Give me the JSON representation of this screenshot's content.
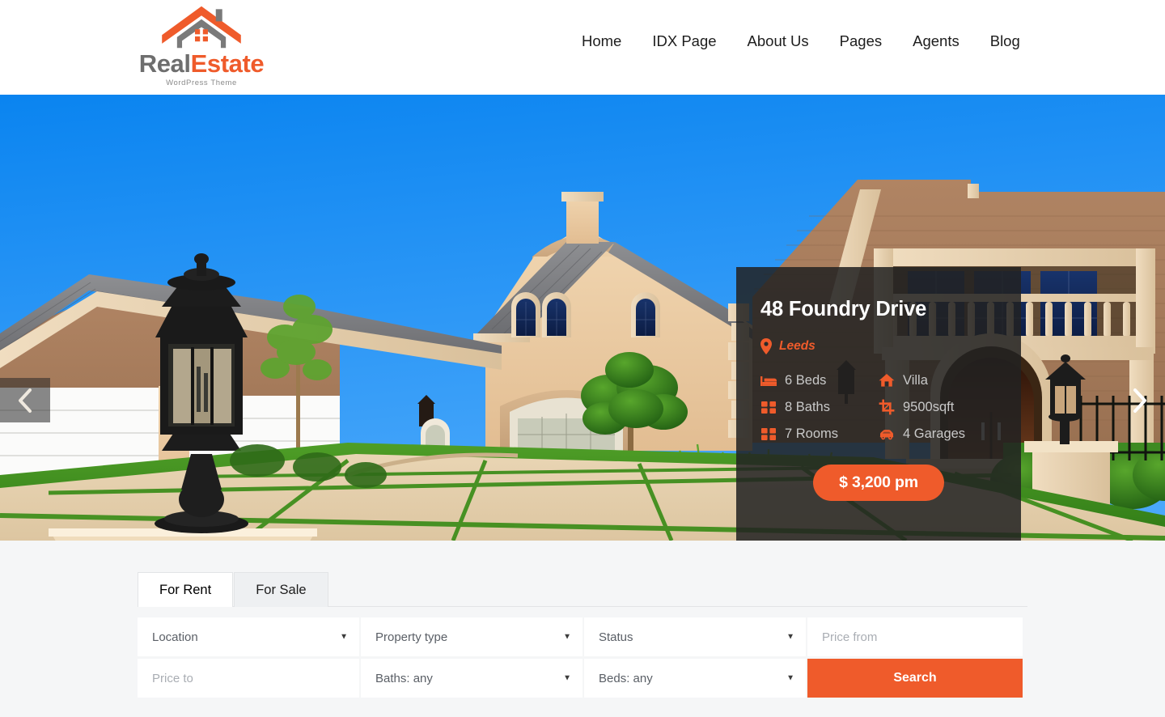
{
  "header": {
    "logo": {
      "word_primary": "Real",
      "word_accent": "Estate",
      "subtitle": "WordPress Theme",
      "icon": "house-logo-icon"
    },
    "nav": [
      {
        "label": "Home",
        "name": "nav-item-home"
      },
      {
        "label": "IDX Page",
        "name": "nav-item-idx-page"
      },
      {
        "label": "About Us",
        "name": "nav-item-about-us"
      },
      {
        "label": "Pages",
        "name": "nav-item-pages"
      },
      {
        "label": "Agents",
        "name": "nav-item-agents"
      },
      {
        "label": "Blog",
        "name": "nav-item-blog"
      }
    ]
  },
  "hero": {
    "prev_label": "‹",
    "next_label": "›",
    "property": {
      "title": "48 Foundry Drive",
      "location": "Leeds",
      "location_icon": "map-pin-icon",
      "specs": [
        {
          "icon": "bed-icon",
          "label": "6 Beds"
        },
        {
          "icon": "home-icon",
          "label": "Villa"
        },
        {
          "icon": "bath-grid-icon",
          "label": "8 Baths"
        },
        {
          "icon": "area-crop-icon",
          "label": "9500sqft"
        },
        {
          "icon": "rooms-grid-icon",
          "label": "7 Rooms"
        },
        {
          "icon": "car-icon",
          "label": "4 Garages"
        }
      ],
      "price": "$ 3,200 pm"
    }
  },
  "search": {
    "tabs": [
      {
        "label": "For Rent",
        "active": true
      },
      {
        "label": "For Sale",
        "active": false
      }
    ],
    "fields": [
      {
        "name": "location-select",
        "value": "Location",
        "type": "select",
        "placeholder": false
      },
      {
        "name": "property-type-select",
        "value": "Property type",
        "type": "select",
        "placeholder": false
      },
      {
        "name": "status-select",
        "value": "Status",
        "type": "select",
        "placeholder": false
      },
      {
        "name": "price-from-input",
        "value": "Price from",
        "type": "input",
        "placeholder": true
      },
      {
        "name": "price-to-input",
        "value": "Price to",
        "type": "input",
        "placeholder": true
      },
      {
        "name": "baths-select",
        "value": "Baths: any",
        "type": "select",
        "placeholder": false
      },
      {
        "name": "beds-select",
        "value": "Beds: any",
        "type": "select",
        "placeholder": false
      }
    ],
    "search_button": "Search"
  },
  "colors": {
    "accent": "#ef5b2b",
    "logo_gray": "#6e6e6e",
    "card_bg": "rgba(34,34,34,0.86)",
    "page_bg": "#f5f6f7",
    "nav_text": "#1d1d1d"
  }
}
